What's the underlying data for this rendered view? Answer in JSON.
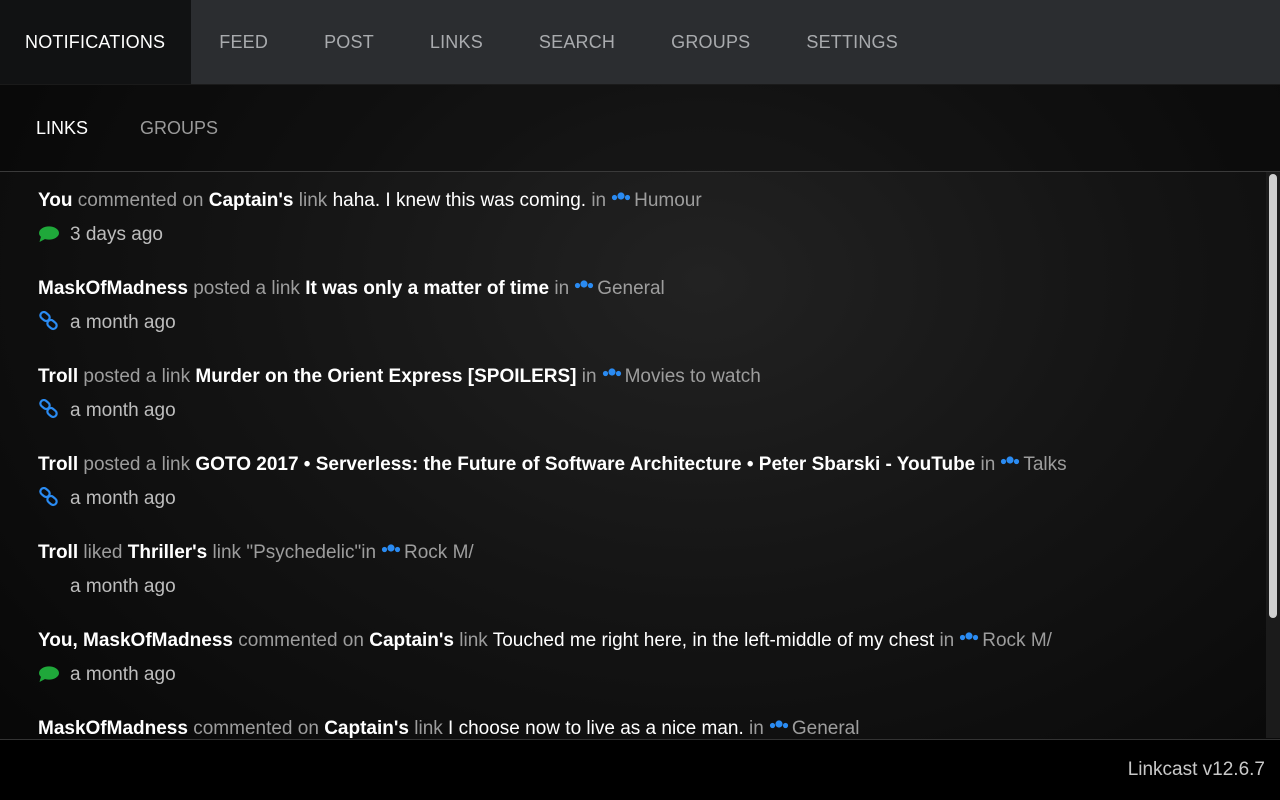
{
  "nav": {
    "tabs": [
      "NOTIFICATIONS",
      "FEED",
      "POST",
      "LINKS",
      "SEARCH",
      "GROUPS",
      "SETTINGS"
    ],
    "active": "NOTIFICATIONS"
  },
  "subnav": {
    "tabs": [
      "LINKS",
      "GROUPS"
    ],
    "active": "LINKS"
  },
  "icons": {
    "comment": "comment-icon",
    "link": "link-icon",
    "like": "heart-icon",
    "group": "users-icon"
  },
  "colors": {
    "group_icon": "#2a8bf2",
    "comment_icon": "#1fa83a",
    "link_icon": "#2a8bf2",
    "heart_icon": "#d63c6c"
  },
  "notifications": [
    {
      "actor": "You",
      "verb": "commented on",
      "owner": "Captain's",
      "obj": "link",
      "title": "haha. I knew this was coming.",
      "title_bold": false,
      "in": "in",
      "group": "Humour",
      "icon": "comment",
      "time": "3 days ago"
    },
    {
      "actor": "MaskOfMadness",
      "verb": "posted a link",
      "owner": "",
      "obj": "",
      "title": "It was only a matter of time",
      "title_bold": true,
      "in": "in",
      "group": "General",
      "icon": "link",
      "time": "a month ago"
    },
    {
      "actor": "Troll",
      "verb": "posted a link",
      "owner": "",
      "obj": "",
      "title": "Murder on the Orient Express [SPOILERS]",
      "title_bold": true,
      "in": "in",
      "group": "Movies to watch",
      "icon": "link",
      "time": "a month ago"
    },
    {
      "actor": "Troll",
      "verb": "posted a link",
      "owner": "",
      "obj": "",
      "title": "GOTO 2017 • Serverless: the Future of Software Architecture • Peter Sbarski - YouTube",
      "title_bold": true,
      "in": "in",
      "group": "Talks",
      "icon": "link",
      "time": "a month ago"
    },
    {
      "actor": "Troll",
      "verb": "liked",
      "owner": "Thriller's",
      "obj": "link",
      "title": "\"Psychedelic\"",
      "title_bold": false,
      "title_gray": true,
      "in": "in",
      "group": "Rock M/",
      "icon": "like",
      "time": "a month ago"
    },
    {
      "actor": "You, MaskOfMadness",
      "verb": "commented on",
      "owner": "Captain's",
      "obj": "link",
      "title": "Touched me right here, in the left-middle of my chest",
      "title_bold": false,
      "in": "in",
      "group": "Rock M/",
      "icon": "comment",
      "time": "a month ago"
    },
    {
      "actor": "MaskOfMadness",
      "verb": "commented on",
      "owner": "Captain's",
      "obj": "link",
      "title": "I choose now to live as a nice man.",
      "title_bold": false,
      "in": "in",
      "group": "General",
      "icon": "comment",
      "time": ""
    }
  ],
  "footer": {
    "version": "Linkcast v12.6.7"
  }
}
